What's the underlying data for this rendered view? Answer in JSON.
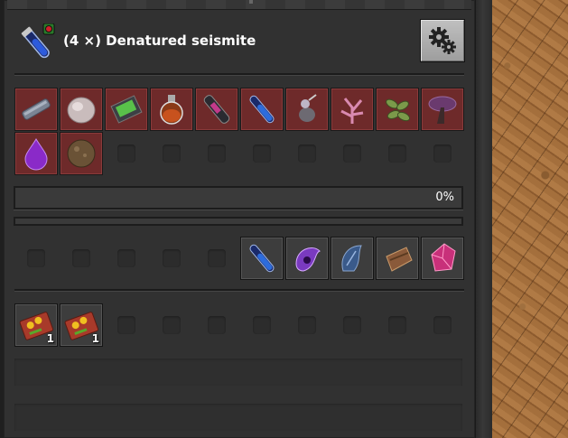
{
  "recipe": {
    "title": "(4 ×) Denatured seismite",
    "icon": "blue-vial-icon",
    "badge_color": "#d0202a"
  },
  "settings_icon": "gear-icon",
  "inputs": {
    "items": [
      {
        "name": "grey-rod-icon"
      },
      {
        "name": "white-rock-icon"
      },
      {
        "name": "green-slab-icon"
      },
      {
        "name": "orange-flask-icon"
      },
      {
        "name": "dark-tube-icon"
      },
      {
        "name": "blue-vial-icon"
      },
      {
        "name": "grey-creature-icon"
      },
      {
        "name": "pink-coral-icon"
      },
      {
        "name": "green-seeds-icon"
      },
      {
        "name": "purple-mushroom-icon"
      },
      {
        "name": "purple-drop-icon"
      },
      {
        "name": "brown-sphere-icon"
      }
    ],
    "empty_slots": 8
  },
  "progress": {
    "label": "0%",
    "value": 0
  },
  "outputs": {
    "empty_slots": 5,
    "items": [
      {
        "name": "blue-vial-icon"
      },
      {
        "name": "purple-shell-icon"
      },
      {
        "name": "blue-fish-icon"
      },
      {
        "name": "brown-pouch-icon"
      },
      {
        "name": "pink-crystal-icon"
      }
    ]
  },
  "modules": {
    "items": [
      {
        "name": "module-icon",
        "count": "1"
      },
      {
        "name": "module-icon",
        "count": "1"
      }
    ],
    "empty_slots": 8
  },
  "colors": {
    "ingredient_slot": "#6e2a2a",
    "progress_fill": "#e89a2c"
  }
}
